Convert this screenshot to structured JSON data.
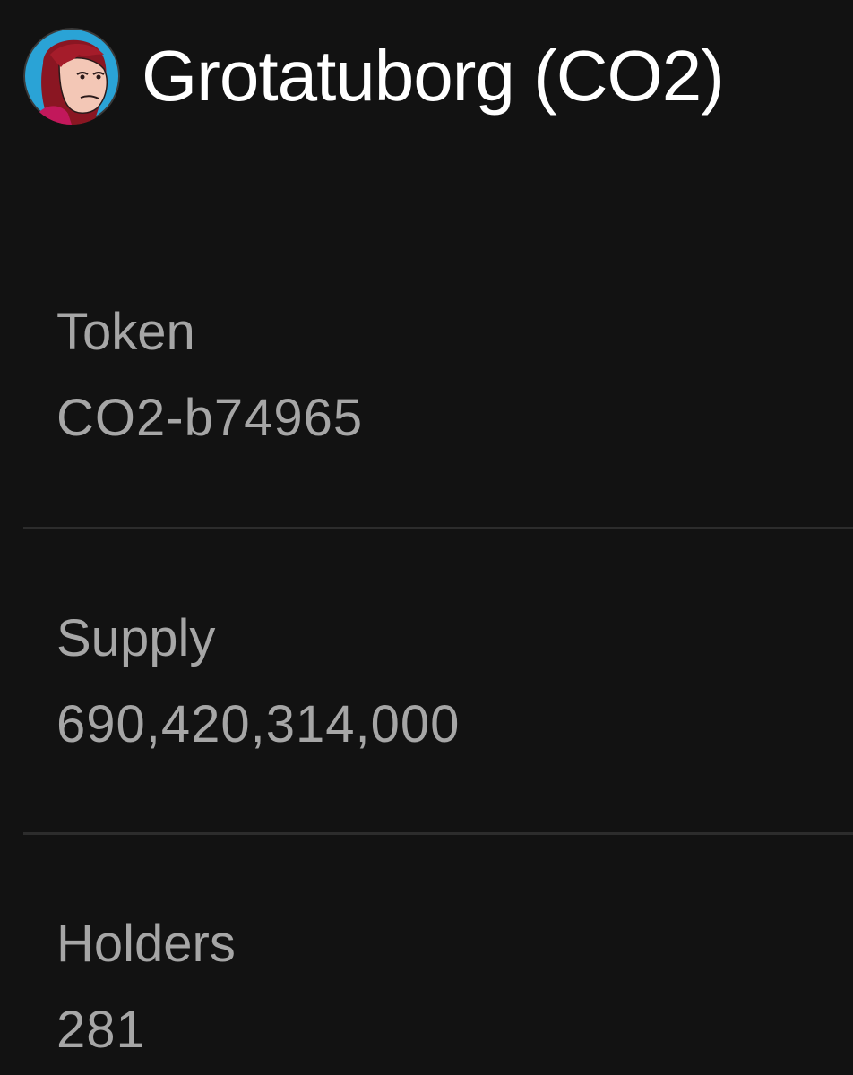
{
  "token_header": {
    "name": "Grotatuborg (CO2)",
    "avatar_icon": "cartoon-portrait-avatar"
  },
  "details": [
    {
      "label": "Token",
      "value": "CO2-b74965"
    },
    {
      "label": "Supply",
      "value": "690,420,314,000"
    },
    {
      "label": "Holders",
      "value": "281"
    }
  ],
  "colors": {
    "background": "#121212",
    "title_text": "#ffffff",
    "detail_text": "#a6a6a6",
    "divider": "#2c2c2c",
    "avatar_background": "#2aa3d6"
  }
}
